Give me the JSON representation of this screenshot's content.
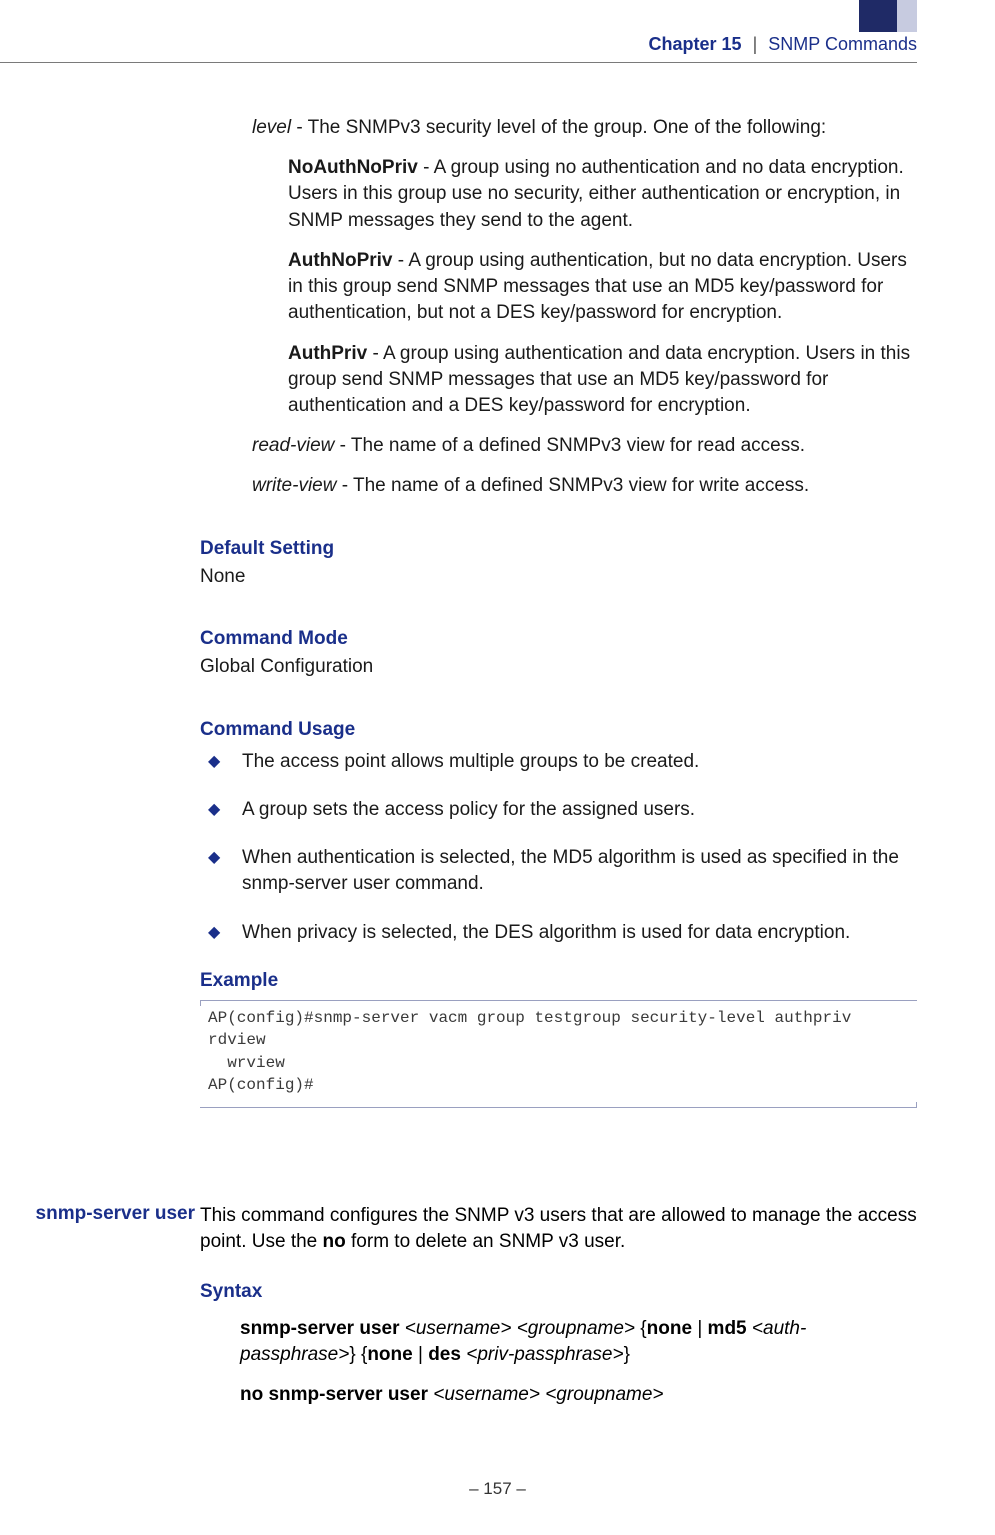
{
  "header": {
    "chapter": "Chapter 15",
    "sep": "|",
    "topic": "SNMP Commands"
  },
  "level": {
    "intro_param": "level",
    "intro_text": " - The SNMPv3 security level of the group. One of the following:",
    "noauth_head": "NoAuthNoPriv",
    "noauth_body": " - A group using no authentication and no data encryption. Users in this group use no security, either authentication or encryption, in SNMP messages they send to the agent.",
    "authno_head": "AuthNoPriv",
    "authno_body": " - A group using authentication, but no data encryption. Users in this group send SNMP messages that use an MD5 key/password for authentication, but not a DES key/password for encryption.",
    "authpriv_head": "AuthPriv",
    "authpriv_body": " - A group using authentication and data encryption. Users in this group send SNMP messages that use an MD5 key/password for authentication and a DES key/password for encryption.",
    "readview_param": "read-view",
    "readview_text": " - The name of a defined SNMPv3 view for read access.",
    "writeview_param": "write-view",
    "writeview_text": " - The name of a defined SNMPv3 view for write access."
  },
  "defset": {
    "h": "Default Setting",
    "v": "None"
  },
  "cmdmode": {
    "h": "Command Mode",
    "v": "Global Configuration"
  },
  "usage": {
    "h": "Command Usage",
    "b1": "The access point allows multiple groups to be created.",
    "b2": "A group sets the access policy for the assigned users.",
    "b3": "When authentication is selected, the MD5 algorithm is used as specified in the snmp-server user command.",
    "b4": "When privacy is selected, the DES algorithm is used for data encryption."
  },
  "example": {
    "h": "Example",
    "code": "AP(config)#snmp-server vacm group testgroup security-level authpriv rdview\n  wrview\nAP(config)#"
  },
  "cmd2": {
    "sidebar": "snmp-server user",
    "desc_pre": "This command configures the SNMP v3 users that are allowed to manage the access point. Use the ",
    "desc_bold": "no",
    "desc_post": " form to delete an SNMP v3 user.",
    "syntax_h": "Syntax",
    "s1_a": "snmp-server user ",
    "s1_b": "<username> <groupname>",
    "s1_c": " {",
    "s1_d": "none",
    "s1_e": " | ",
    "s1_f": "md5 ",
    "s1_g": "<auth-passphrase>",
    "s1_h": "} {",
    "s1_i": "none",
    "s1_j": " | ",
    "s1_k": "des ",
    "s1_l": "<priv-passphrase>",
    "s1_m": "}",
    "s2_a": "no snmp-server user ",
    "s2_b": "<username> <groupname>"
  },
  "footer": "–  157  –"
}
